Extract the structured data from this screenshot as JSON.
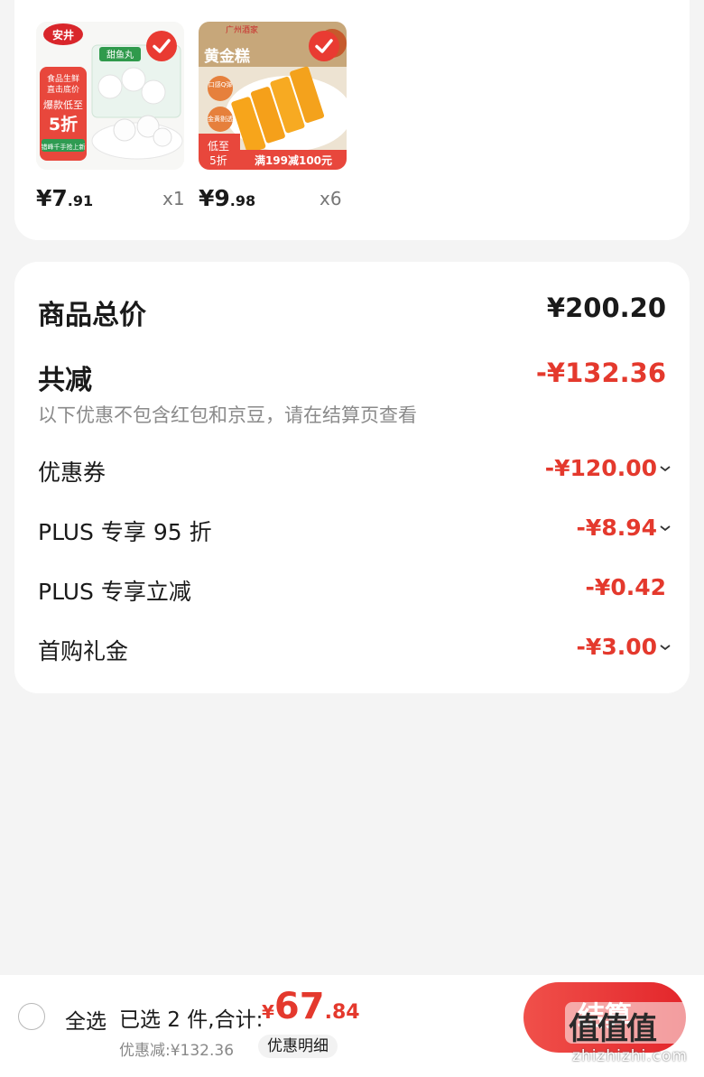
{
  "products": [
    {
      "name": "fish-balls",
      "price_int": "¥7",
      "price_dec": ".91",
      "qty": "x1",
      "brand_text": "安井",
      "item_text": "甜鱼丸",
      "promo_lines": [
        "食品生鲜",
        "直击底价",
        "爆款低至",
        "5折",
        "错峰千手抢上新"
      ]
    },
    {
      "name": "golden-cake",
      "price_int": "¥9",
      "price_dec": ".98",
      "qty": "x6",
      "brand_text": "广州酒家",
      "title_text": "黄金糕",
      "badges": [
        "口感Q弹",
        "金黄剔透"
      ],
      "promo_low": "低至",
      "promo_5": "5折",
      "promo_strip": "满199减100元"
    }
  ],
  "summary": {
    "total_label": "商品总价",
    "total_value": "¥200.20",
    "reduce_label": "共减",
    "reduce_value": "-¥132.36",
    "note": "以下优惠不包含红包和京豆，请在结算页查看",
    "items": [
      {
        "label": "优惠券",
        "value": "-¥120.00",
        "chevron": true
      },
      {
        "label": "PLUS 专享 95 折",
        "value": "-¥8.94",
        "chevron": true
      },
      {
        "label": "PLUS 专享立减",
        "value": "-¥0.42",
        "chevron": false
      },
      {
        "label": "首购礼金",
        "value": "-¥3.00",
        "chevron": true
      }
    ]
  },
  "footer": {
    "select_all": "全选",
    "selected_text": "已选 2 件,合计:",
    "total_symbol": "¥",
    "total_int": "67",
    "total_dec": ".84",
    "discount_text": "优惠减:¥132.36",
    "detail_btn": "优惠明细",
    "checkout_btn": "结算"
  },
  "watermark": {
    "logo": "值值值",
    "site": "zhizhizhi.com"
  },
  "colors": {
    "accent": "#e93b32",
    "price_red": "#e4392d",
    "bg": "#f4f4f4"
  }
}
